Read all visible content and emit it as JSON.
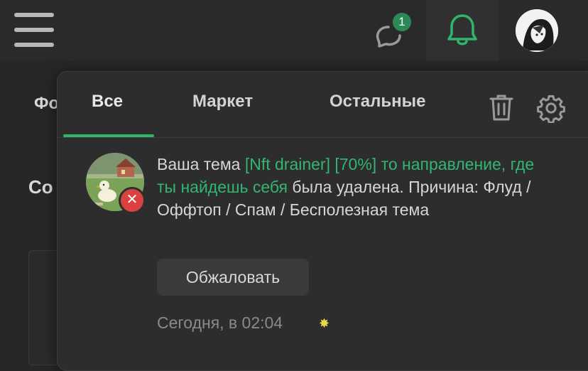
{
  "header": {
    "chat_badge_count": "1",
    "icons": [
      "menu-icon",
      "chat-icon",
      "bell-icon",
      "user-avatar"
    ],
    "accent_color": "#2fb56c"
  },
  "background": {
    "fragment_1": "Фо",
    "fragment_2": "Со"
  },
  "notifications": {
    "tabs": [
      {
        "label": "Все",
        "active": true
      },
      {
        "label": "Маркет",
        "active": false
      },
      {
        "label": "Остальные",
        "active": false
      }
    ],
    "items": [
      {
        "text_before": "Ваша тема ",
        "thread_link": "[Nft drainer] [70%] то направление, где ты найдешь себя",
        "text_after": " была удалена. Причина: Флуд / Оффтоп / Спам / Бесполезная тема",
        "status": "deleted",
        "status_color": "#d9423e",
        "action_label": "Обжаловать",
        "time": "Сегодня, в 02:04"
      }
    ]
  }
}
